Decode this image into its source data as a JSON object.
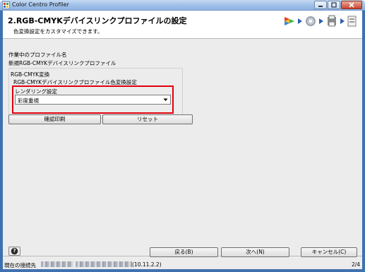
{
  "window": {
    "title": "Color Centro Profiler"
  },
  "header": {
    "title": "2.RGB-CMYKデバイスリンクプロファイルの設定",
    "subtitle": "色変換設定をカスタマイズできます。"
  },
  "profile": {
    "label": "作業中のプロファイル名",
    "value": "新規RGB-CMYKデバイスリンクプロファイル"
  },
  "conversion": {
    "group_label": "RGB-CMYK変換",
    "section_label": "RGB-CMYKデバイスリンクプロファイル色変換設定",
    "rendering_label": "レンダリング設定",
    "rendering_value": "彩度重視"
  },
  "actions": {
    "confirm_print": "確認印刷",
    "reset": "リセット"
  },
  "footer": {
    "help_label": "?",
    "back": "戻る(B)",
    "next": "次へ(N)",
    "cancel": "キャンセル(C)"
  },
  "status": {
    "connection_label": "現在の接続先",
    "ip_suffix": "(10.11.2.2)",
    "page": "2/4"
  },
  "colors": {
    "highlight": "#e0000e",
    "title_bar": "#9ebfe8"
  },
  "icons": [
    "app-icon",
    "monitor-icon",
    "gear-icon",
    "printer-icon",
    "profile-icon",
    "dropdown-arrow-icon",
    "help-icon"
  ]
}
